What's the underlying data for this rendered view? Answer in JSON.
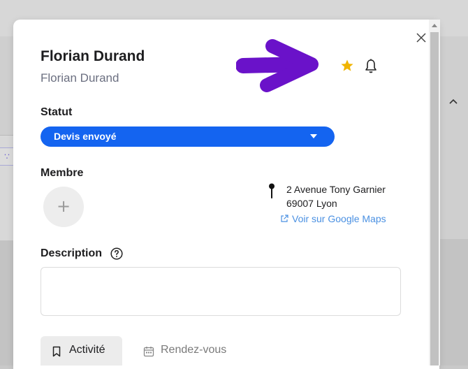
{
  "contact": {
    "name": "Florian Durand",
    "subtitle": "Florian Durand"
  },
  "status": {
    "label": "Statut",
    "selected": "Devis envoyé",
    "color": "#1464f0"
  },
  "member": {
    "label": "Membre",
    "add_symbol": "+"
  },
  "address": {
    "line1": "2 Avenue Tony Garnier",
    "line2": "69007 Lyon",
    "maps_link": "Voir sur Google Maps"
  },
  "description": {
    "label": "Description",
    "value": ""
  },
  "tabs": [
    {
      "label": "Activité",
      "icon": "bookmark-icon",
      "active": true
    },
    {
      "label": "Rendez-vous",
      "icon": "calendar-icon",
      "active": false
    }
  ],
  "header_icons": {
    "favorite": "star-icon",
    "favorite_color": "#f0b400",
    "notifications": "bell-icon",
    "close": "close-icon"
  },
  "annotation": {
    "arrow_color": "#6a12c9"
  }
}
